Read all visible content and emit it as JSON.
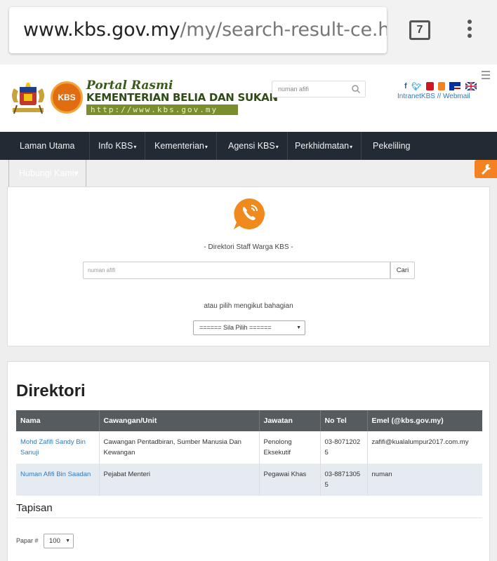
{
  "browser": {
    "url_host": "www.kbs.gov.my",
    "url_path": "/my/search-result-ce.htm",
    "tab_count": "7"
  },
  "header": {
    "logo_text": "KBS",
    "title_line1": "Portal Rasmi",
    "title_line2": "KEMENTERIAN BELIA DAN SUKAN",
    "title_line3": "http://www.kbs.gov.my",
    "search_value": "numan afifi",
    "intranet_link": "IntranetKBS",
    "separator": "//",
    "webmail_link": "Webmail"
  },
  "nav": {
    "items": [
      {
        "label": "Laman Utama",
        "caret": ""
      },
      {
        "label": "Info KBS",
        "caret": "▾"
      },
      {
        "label": "Kementerian",
        "caret": "▾"
      },
      {
        "label": "Agensi KBS",
        "caret": "▾"
      },
      {
        "label": "Perkhidmatan",
        "caret": "▾"
      },
      {
        "label": "Pekeliling",
        "caret": ""
      }
    ],
    "hubungi": "Hubungi Kami▾"
  },
  "directory_search": {
    "heading": "- Direktori Staff Warga KBS -",
    "input_value": "numan afifi",
    "button_label": "Cari",
    "or_text": "atau pilih mengikut bahagian",
    "select_value": "====== Sila Pilih ======"
  },
  "directory": {
    "title": "Direktori",
    "columns": [
      "Nama",
      "Cawangan/Unit",
      "Jawatan",
      "No Tel",
      "Emel (@kbs.gov.my)"
    ],
    "rows": [
      {
        "nama": "Mohd Zafifi Sandy Bin Sanuji",
        "cawangan": "Cawangan Pentadbiran, Sumber Manusia Dan Kewangan",
        "jawatan": "Penolong Eksekutif",
        "tel": "03-80712025",
        "emel": "zafifi@kualalumpur2017.com.my"
      },
      {
        "nama": "Numan Afifi Bin Saadan",
        "cawangan": "Pejabat Menteri",
        "jawatan": "Pegawai Khas",
        "tel": "03-88713055",
        "emel": "numan"
      }
    ],
    "filter_title": "Tapisan",
    "papar_label": "Papar #",
    "papar_value": "100"
  },
  "colors": {
    "nav_bg": "#222a33",
    "accent_orange": "#f58220",
    "link_blue": "#2f7bbf",
    "table_header": "#555b5f"
  }
}
